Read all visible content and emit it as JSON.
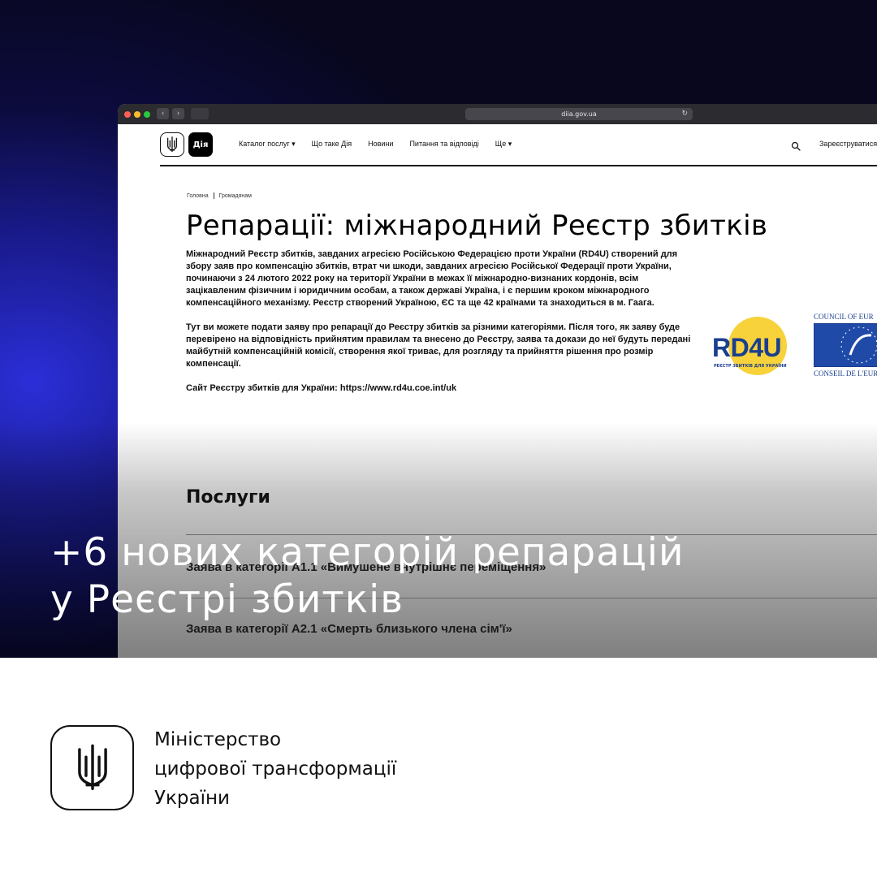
{
  "browser": {
    "url": "diia.gov.ua"
  },
  "header": {
    "diia_logo": "Дія",
    "menu": [
      "Каталог послуг ▾",
      "Що таке Дія",
      "Новини",
      "Питання та відповіді",
      "Ще ▾"
    ],
    "register": "Зареєструватися"
  },
  "breadcrumb": {
    "home": "Головна",
    "current": "Громадянам"
  },
  "page": {
    "title": "Репарації: міжнародний Реєстр збитків",
    "paragraphs": [
      "Міжнародний Реєстр збитків, завданих агресією Російською Федерацією проти України (RD4U) створений для збору заяв про компенсацію збитків, втрат чи шкоди, завданих агресією Російської Федерації проти України, починаючи з 24 лютого 2022 року на території України в межах її міжнародно-визнаних кордонів, всім зацікавленим фізичним і юридичним особам, а також державі Україна, і є першим кроком міжнародного компенсаційного механізму. Реєстр створений Україною, ЄС та ще 42 країнами та знаходиться в м. Гаага.",
      "Тут ви можете подати заяву про репарації до Реєстру збитків за різними категоріями. Після того, як заяву буде перевірено на відповідність прийнятим правилам та внесено до Реєстру, заява та докази до неї будуть передані майбутній компенсаційній комісії, створення якої триває, для розгляду та прийняття рішення про розмір компенсації.",
      "Сайт Реєстру збитків для України: https://www.rd4u.coe.int/uk"
    ]
  },
  "logos": {
    "rd4u": "RD4U",
    "rd4u_sub": "РЕЄСТР ЗБИТКІВ ДЛЯ УКРАЇНИ",
    "coe_top": "COUNCIL OF EUR",
    "coe_bottom": "CONSEIL DE L'EUR"
  },
  "services": {
    "title": "Послуги",
    "items": [
      "Заява в категорії А1.1 «Вимушене внутрішнє переміщення»",
      "Заява в категорії А2.1 «Смерть близького члена сім'ї»"
    ]
  },
  "headline": {
    "line1": "+6 нових категорій репарацій",
    "line2": "у Реєстрі збитків"
  },
  "ministry": {
    "line1": "Міністерство",
    "line2": "цифрової трансформації",
    "line3": "України"
  },
  "colors": {
    "background_dark": "#0c0b3d",
    "background_glow": "#2b2fd8",
    "rd4u_blue": "#1b3f8f",
    "rd4u_yellow": "#f7d23a"
  }
}
